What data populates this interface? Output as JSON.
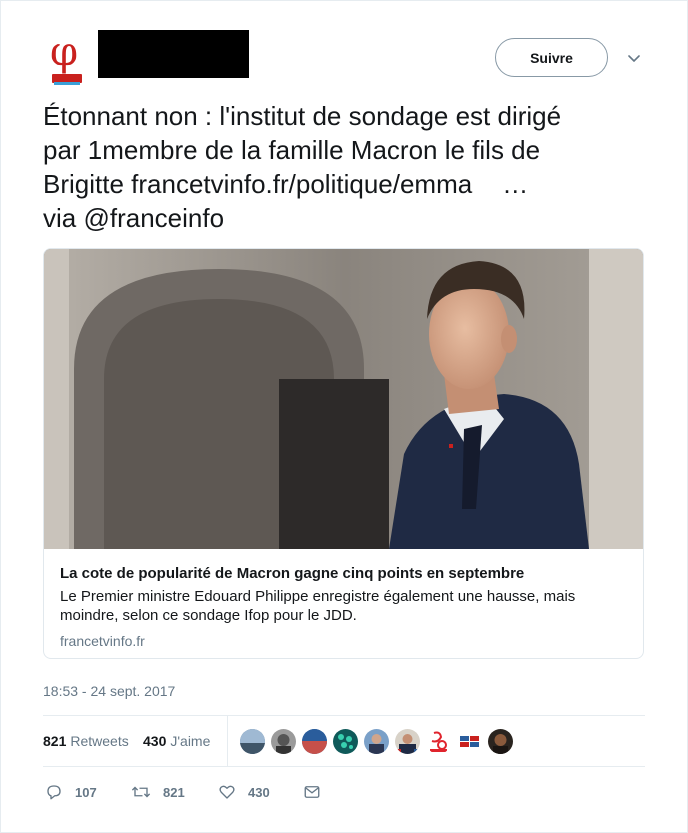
{
  "author": {
    "avatar_glyph": "φ",
    "avatar_colors": {
      "primary": "#c9211e",
      "secondary": "#3aa0d8"
    }
  },
  "follow_button": {
    "label": "Suivre"
  },
  "tweet": {
    "lines": [
      "Étonnant non : l'institut de sondage est dirigé",
      "par 1membre de la famille Macron le fils de"
    ],
    "line3_prefix": "Brigitte ",
    "link_text": "francetvinfo.fr/politique/emma",
    "ellipsis": "…",
    "line4": "via @franceinfo"
  },
  "card": {
    "title": "La cote de popularité de Macron gagne cinq points en septembre",
    "description": "Le Premier ministre Edouard Philippe enregistre également une hausse, mais moindre, selon ce sondage Ifop pour le JDD.",
    "domain": "francetvinfo.fr"
  },
  "timestamp": "18:53 - 24 sept. 2017",
  "stats": {
    "retweets_count": "821",
    "retweets_label": "Retweets",
    "likes_count": "430",
    "likes_label": "J'aime"
  },
  "actions": {
    "reply_count": "107",
    "retweet_count": "821",
    "like_count": "430"
  },
  "colors": {
    "text": "#14171a",
    "muted": "#657786",
    "border": "#e6ecf0"
  }
}
